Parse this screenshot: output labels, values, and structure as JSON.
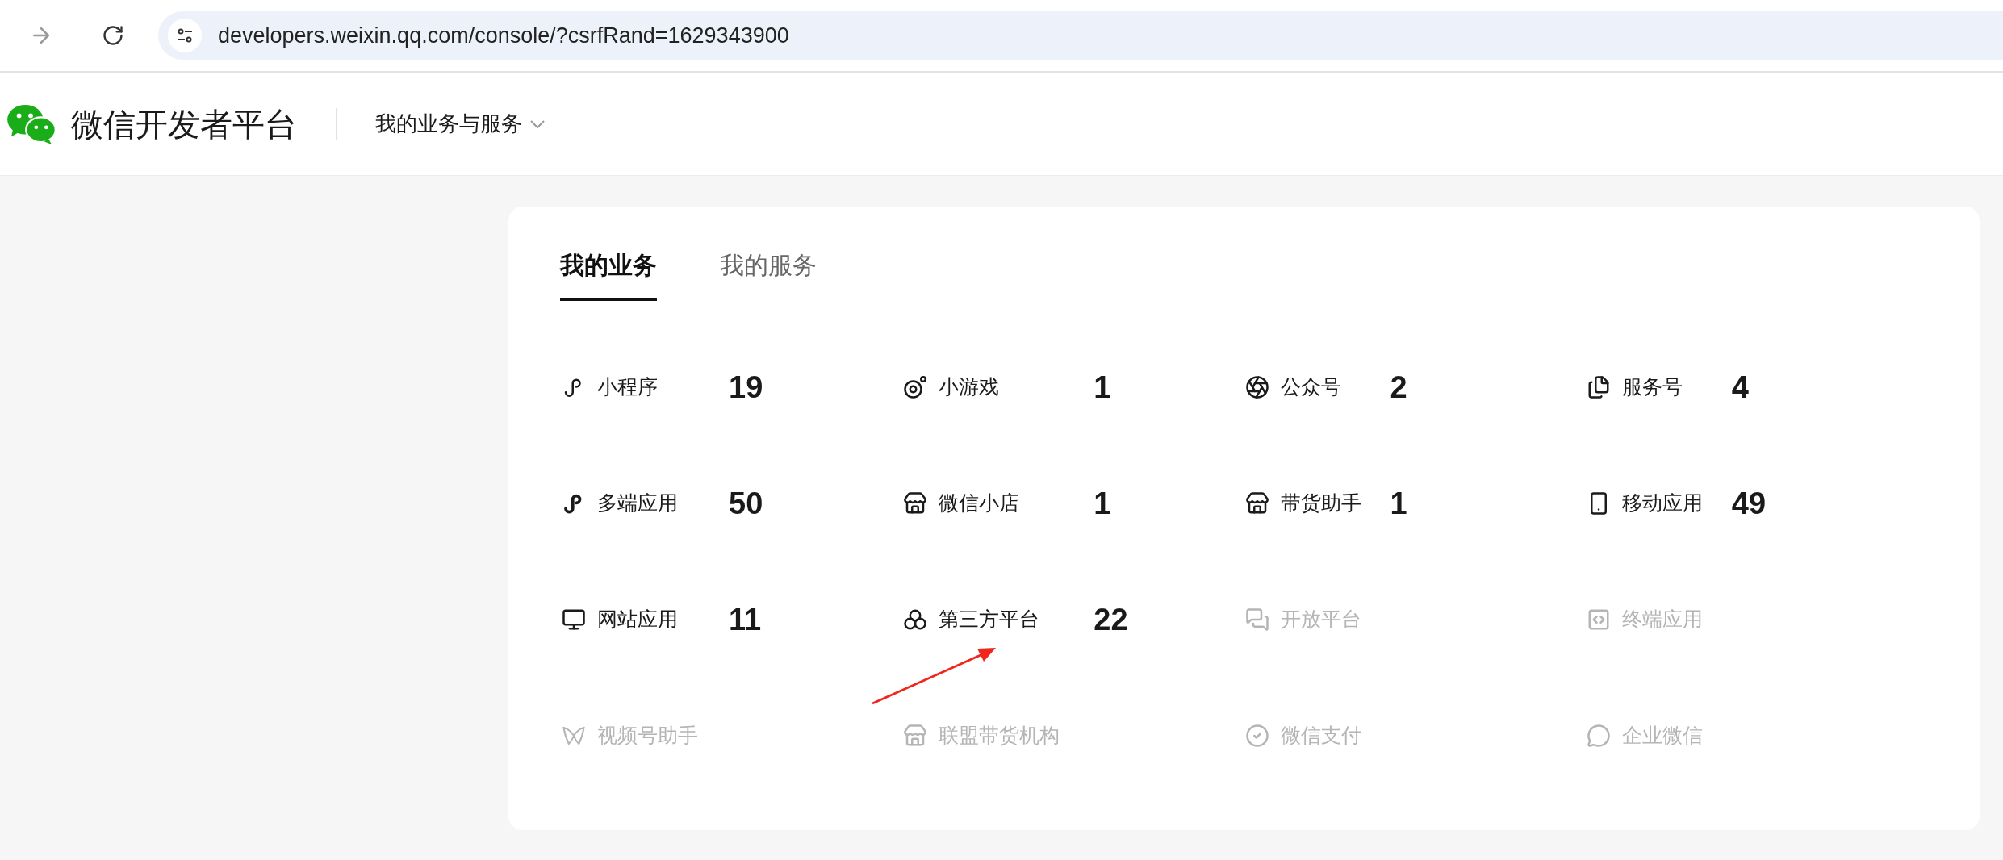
{
  "browser": {
    "url": "developers.weixin.qq.com/console/?csrfRand=1629343900"
  },
  "header": {
    "title": "微信开发者平台",
    "menu": "我的业务与服务"
  },
  "tabs": [
    {
      "label": "我的业务",
      "selected": true
    },
    {
      "label": "我的服务",
      "selected": false
    }
  ],
  "items": [
    {
      "label": "小程序",
      "count": "19",
      "disabled": false
    },
    {
      "label": "小游戏",
      "count": "1",
      "disabled": false
    },
    {
      "label": "公众号",
      "count": "2",
      "disabled": false
    },
    {
      "label": "服务号",
      "count": "4",
      "disabled": false
    },
    {
      "label": "多端应用",
      "count": "50",
      "disabled": false
    },
    {
      "label": "微信小店",
      "count": "1",
      "disabled": false
    },
    {
      "label": "带货助手",
      "count": "1",
      "disabled": false
    },
    {
      "label": "移动应用",
      "count": "49",
      "disabled": false
    },
    {
      "label": "网站应用",
      "count": "11",
      "disabled": false
    },
    {
      "label": "第三方平台",
      "count": "22",
      "disabled": false
    },
    {
      "label": "开放平台",
      "disabled": true
    },
    {
      "label": "终端应用",
      "disabled": true
    },
    {
      "label": "视频号助手",
      "disabled": true
    },
    {
      "label": "联盟带货机构",
      "disabled": true
    },
    {
      "label": "微信支付",
      "disabled": true
    },
    {
      "label": "企业微信",
      "disabled": true
    }
  ]
}
